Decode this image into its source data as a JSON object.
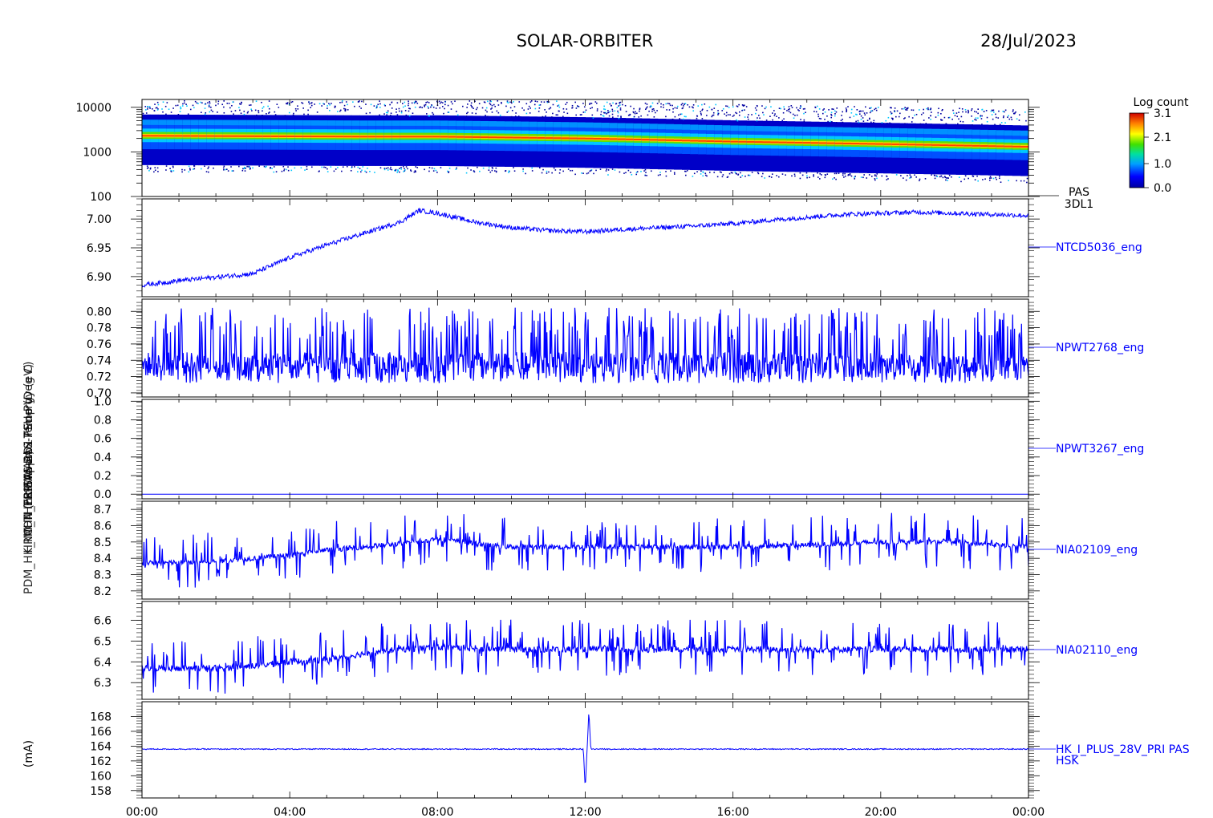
{
  "header": {
    "mission": "SOLAR-ORBITER",
    "date": "28/Jul/2023"
  },
  "colorbar": {
    "title": "Log count",
    "ticks": [
      "3.1",
      "2.1",
      "1.0",
      "0.0"
    ],
    "min": 0.0,
    "max": 3.1
  },
  "left_axis_label": "(mA)",
  "overlapping_ylabels": [
    "Energy (eV)",
    "Approx Temp (Deg C)",
    "SWA-EAS-PSU-PV",
    "TS-EAS-AD17",
    "CH4 (nc-SWA2)",
    "HRM_THERM",
    "PDM_HK_IMON_PRI"
  ],
  "x_ticks": [
    "00:00",
    "04:00",
    "08:00",
    "12:00",
    "16:00",
    "20:00",
    "00:00"
  ],
  "chart_data": [
    {
      "type": "heatmap",
      "panel": 1,
      "ylabel": "Energy (eV)",
      "yscale": "log",
      "ylim": [
        100,
        15000
      ],
      "yticks": [
        "10000",
        "1000",
        "100"
      ],
      "right_label_1": "PAS",
      "right_label_2": "3DL1",
      "band_center_eV": [
        [
          0,
          2300
        ],
        [
          6,
          2200
        ],
        [
          8,
          2200
        ],
        [
          12,
          2000
        ],
        [
          16,
          1700
        ],
        [
          20,
          1500
        ],
        [
          24,
          1300
        ]
      ]
    },
    {
      "type": "line",
      "panel": 2,
      "name": "NTCD5036_eng",
      "ylabel": "Approx Temp (Deg C)",
      "ylim": [
        6.865,
        7.035
      ],
      "yticks": [
        "7.00",
        "6.95",
        "6.90"
      ],
      "x_hours": [
        0,
        1,
        2,
        3,
        4,
        5,
        6,
        7,
        7.5,
        8,
        9,
        10,
        11,
        12,
        13,
        14,
        15,
        16,
        17,
        18,
        19,
        20,
        21,
        22,
        23,
        24
      ],
      "y": [
        6.885,
        6.893,
        6.899,
        6.905,
        6.933,
        6.955,
        6.975,
        6.995,
        7.015,
        7.01,
        6.995,
        6.985,
        6.98,
        6.978,
        6.982,
        6.985,
        6.988,
        6.992,
        6.998,
        7.003,
        7.008,
        7.01,
        7.012,
        7.01,
        7.008,
        7.006
      ]
    },
    {
      "type": "line",
      "panel": 3,
      "name": "NPWT2768_eng",
      "ylabel": "SWA-EAS-PSU-PV",
      "ylim": [
        0.695,
        0.815
      ],
      "yticks": [
        "0.80",
        "0.78",
        "0.76",
        "0.74",
        "0.72",
        "0.70"
      ],
      "x_hours": [
        0,
        6,
        12,
        18,
        24
      ],
      "y": [
        0.735,
        0.735,
        0.735,
        0.735,
        0.732
      ],
      "noise_low": 0.712,
      "noise_high": 0.805
    },
    {
      "type": "line",
      "panel": 4,
      "name": "NPWT3267_eng",
      "ylabel": "TS-EAS-AD17",
      "ylim": [
        -0.05,
        1.02
      ],
      "yticks": [
        "1.0",
        "0.8",
        "0.6",
        "0.4",
        "0.2",
        "0.0"
      ],
      "x_hours": [
        0,
        24
      ],
      "y": [
        0.0,
        0.0
      ]
    },
    {
      "type": "line",
      "panel": 5,
      "name": "NIA02109_eng",
      "ylabel": "CH4 (nc-SWA2)",
      "ylim": [
        8.15,
        8.75
      ],
      "yticks": [
        "8.7",
        "8.6",
        "8.5",
        "8.4",
        "8.3",
        "8.2"
      ],
      "x_hours": [
        0,
        2,
        3,
        4,
        5,
        6,
        7,
        8,
        9,
        10,
        12,
        14,
        16,
        18,
        20,
        22,
        24
      ],
      "y": [
        8.37,
        8.38,
        8.4,
        8.42,
        8.45,
        8.47,
        8.49,
        8.52,
        8.49,
        8.47,
        8.47,
        8.47,
        8.47,
        8.48,
        8.5,
        8.5,
        8.47
      ]
    },
    {
      "type": "line",
      "panel": 6,
      "name": "NIA02110_eng",
      "ylabel": "HRM_THERM",
      "ylim": [
        6.22,
        6.69
      ],
      "yticks": [
        "6.6",
        "6.5",
        "6.4",
        "6.3"
      ],
      "x_hours": [
        0,
        2,
        3,
        4,
        5,
        6,
        7,
        8,
        10,
        12,
        14,
        16,
        18,
        20,
        22,
        24
      ],
      "y": [
        6.37,
        6.37,
        6.38,
        6.4,
        6.41,
        6.44,
        6.46,
        6.47,
        6.46,
        6.46,
        6.46,
        6.46,
        6.46,
        6.46,
        6.46,
        6.46
      ]
    },
    {
      "type": "line",
      "panel": 7,
      "name": "HK_I_PLUS_28V_PRI PAS",
      "right_label_2": "HSK",
      "ylabel": "PDM_HK_IMON_PRI",
      "ylim": [
        157,
        170
      ],
      "yticks": [
        "168",
        "166",
        "164",
        "162",
        "160",
        "158"
      ],
      "x_hours": [
        0,
        11.95,
        12.0,
        12.05,
        12.1,
        12.15,
        24
      ],
      "y": [
        163.6,
        163.6,
        158.2,
        163.6,
        168.8,
        163.6,
        163.6
      ]
    }
  ]
}
